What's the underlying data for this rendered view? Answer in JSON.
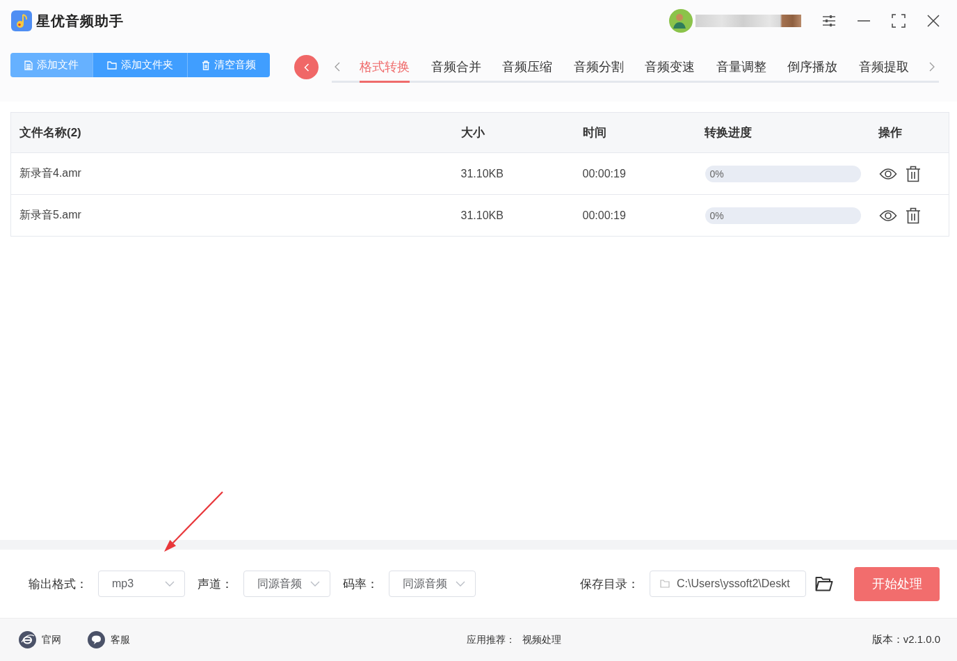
{
  "window": {
    "title": "星优音频助手"
  },
  "toolbar": {
    "buttons": [
      {
        "label": "添加文件",
        "kind": "file",
        "highlighted": true
      },
      {
        "label": "添加文件夹",
        "kind": "folder",
        "highlighted": false
      },
      {
        "label": "清空音频",
        "kind": "trash",
        "highlighted": false
      }
    ]
  },
  "tabs": {
    "items": [
      {
        "label": "格式转换",
        "selected": true
      },
      {
        "label": "音频合并",
        "selected": false
      },
      {
        "label": "音频压缩",
        "selected": false
      },
      {
        "label": "音频分割",
        "selected": false
      },
      {
        "label": "音频变速",
        "selected": false
      },
      {
        "label": "音量调整",
        "selected": false
      },
      {
        "label": "倒序播放",
        "selected": false
      },
      {
        "label": "音频提取",
        "selected": false
      }
    ]
  },
  "table": {
    "columns": [
      "文件名称(2)",
      "大小",
      "时间",
      "转换进度",
      "操作"
    ],
    "rows": [
      {
        "name": "新录音4.amr",
        "size": "31.10KB",
        "duration": "00:00:19",
        "progress": {
          "level": 0,
          "reading": "0%"
        }
      },
      {
        "name": "新录音5.amr",
        "size": "31.10KB",
        "duration": "00:00:19",
        "progress": {
          "level": 0,
          "reading": "0%"
        }
      }
    ]
  },
  "settings": {
    "selects": [
      {
        "label": "输出格式：",
        "value": "mp3"
      },
      {
        "label": "声道：",
        "value": "同源音频"
      },
      {
        "label": "码率：",
        "value": "同源音频"
      }
    ],
    "save_dir": {
      "label": "保存目录：",
      "value": "C:\\Users\\yssoft2\\Deskt"
    },
    "start_button": "开始处理"
  },
  "footer": {
    "links": [
      {
        "label": "官网",
        "kind": "web"
      },
      {
        "label": "客服",
        "kind": "chat"
      }
    ],
    "recommend": {
      "label": "应用推荐：",
      "app": "视频处理"
    },
    "version": "版本：v2.1.0.0"
  }
}
